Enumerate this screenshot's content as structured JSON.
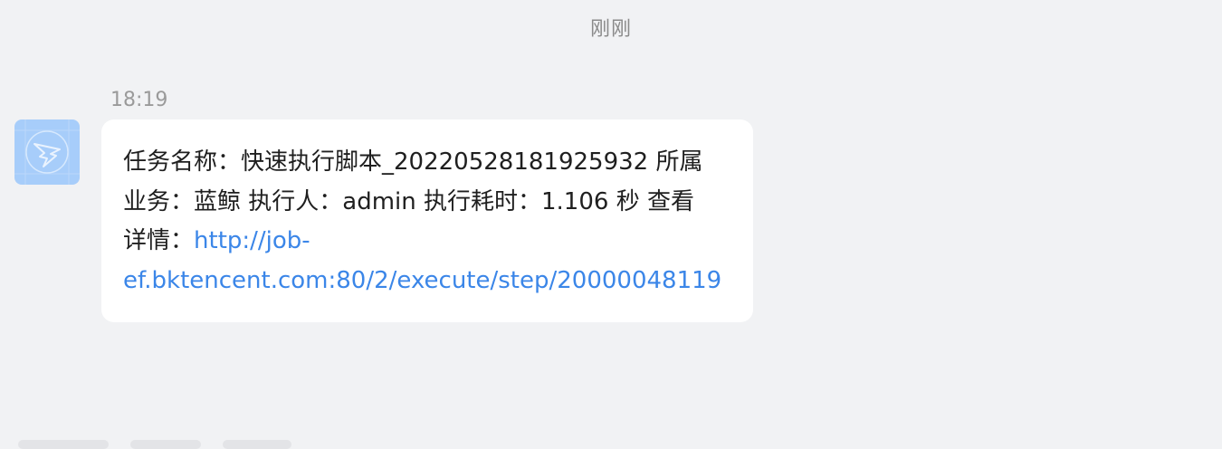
{
  "divider": {
    "time": "刚刚"
  },
  "message": {
    "timestamp": "18:19",
    "avatar_icon": "dingtalk-wing-icon",
    "lines": [
      "任务名称：快速执行脚本_20220528181925932 所属",
      "业务：蓝鲸 执行人：admin 执行耗时：1.106 秒 查看"
    ],
    "details_label": "详情：",
    "link_part1": "http://job-",
    "link_part2": "ef.bktencent.com:80/2/execute/step/20000048119"
  },
  "colors": {
    "background": "#f1f2f4",
    "bubble": "#ffffff",
    "link": "#3b86e8",
    "avatar": "#a7cdfa"
  }
}
